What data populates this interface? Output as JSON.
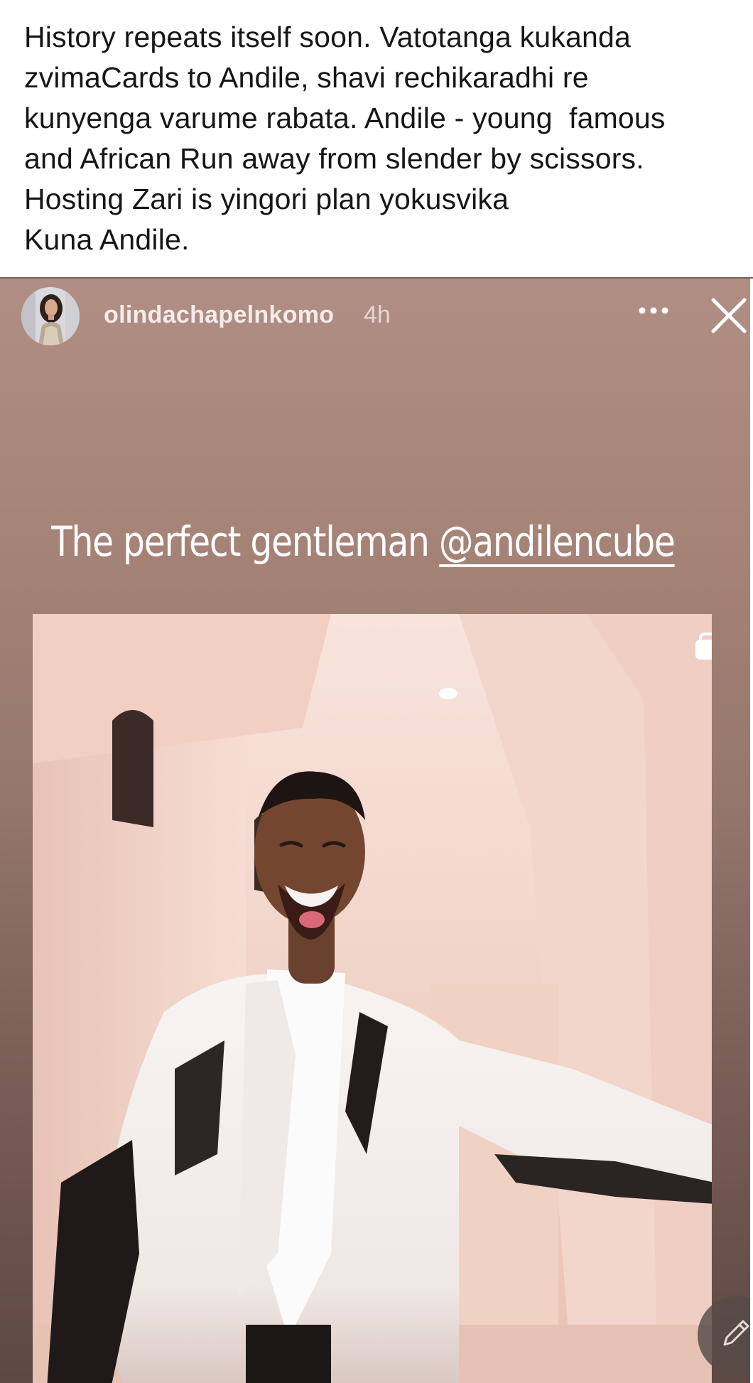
{
  "post": {
    "caption_lines": [
      "History repeats itself soon. Vatotanga kukanda",
      "zvimaCards to Andile, shavi rechikaradhi re",
      "kunyenga varume rabata. Andile - young  famous",
      "and African Run away from slender by scissors.",
      "Hosting Zari is yingori plan yokusvika",
      "Kuna Andile."
    ]
  },
  "story": {
    "username": "olindachapelnkomo",
    "time_ago": "4h",
    "headline_text": "The perfect gentleman ",
    "mention": "@andilencube",
    "icons": {
      "more": "more-dots-icon",
      "close": "close-icon",
      "carousel": "carousel-icon",
      "edit": "pencil-icon"
    }
  },
  "colors": {
    "caption_text": "#161616",
    "story_bg_top": "#b08e83",
    "story_bg_bottom": "#5d4842",
    "photo_wall": "#f2d3c8"
  }
}
